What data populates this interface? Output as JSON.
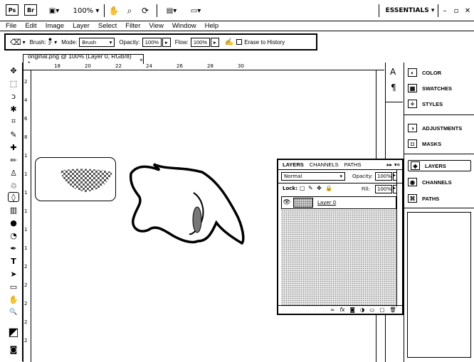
{
  "appbar": {
    "zoom": "100%",
    "workspace": "ESSENTIALS",
    "icons": [
      "ps-logo-icon",
      "bridge-icon",
      "view-extras-icon",
      "hand-icon",
      "zoom-icon",
      "rotate-view-icon",
      "arrange-documents-icon",
      "screen-mode-icon",
      "search-icon",
      "minimize-icon",
      "restore-icon",
      "close-icon"
    ]
  },
  "menu": [
    "File",
    "Edit",
    "Image",
    "Layer",
    "Select",
    "Filter",
    "View",
    "Window",
    "Help"
  ],
  "options": {
    "brush_label": "Brush:",
    "brush_size": "3\"",
    "mode_label": "Mode:",
    "mode_value": "Brush",
    "opacity_label": "Opacity:",
    "opacity_value": "100%",
    "flow_label": "Flow:",
    "flow_value": "100%",
    "erase_label": "Erase to History"
  },
  "document": {
    "tab_title": "original.png @ 100% (Layer 0, RGB/8) *",
    "close_glyph": "×",
    "ruler_top": [
      "18",
      "20",
      "22",
      "24",
      "26",
      "28",
      "30"
    ],
    "ruler_left": [
      "2",
      "4",
      "6",
      "8",
      "1",
      "1",
      "1",
      "1",
      "1",
      "1",
      "2",
      "2",
      "2",
      "2",
      "2"
    ]
  },
  "tools": [
    "move-tool",
    "marquee-tool",
    "lasso-tool",
    "magic-wand-tool",
    "crop-tool",
    "eyedropper-tool",
    "healing-tool",
    "brush-tool",
    "stamp-tool",
    "history-brush-tool",
    "eraser-tool",
    "gradient-tool",
    "blur-tool",
    "dodge-tool",
    "pen-tool",
    "type-tool",
    "path-selection-tool",
    "shape-tool",
    "hand-tool",
    "zoom-tool",
    "color-swatch",
    "quick-mask-tool"
  ],
  "tool_glyphs": [
    "✥",
    "⬚",
    "ↄ",
    "✱",
    "⌗",
    "✎",
    "✚",
    "✏",
    "♙",
    "♲",
    "◊",
    "▥",
    "●",
    "◔",
    "✒",
    "T",
    "➤",
    "▭",
    "✋",
    "🔍",
    "◩",
    "◙"
  ],
  "dock_left": {
    "glyphs": [
      "A",
      "¶"
    ]
  },
  "panels": [
    {
      "label": "COLOR",
      "glyph": "◐"
    },
    {
      "label": "SWATCHES",
      "glyph": "▦"
    },
    {
      "label": "STYLES",
      "glyph": "✧"
    },
    {
      "label": "ADJUSTMENTS",
      "glyph": "◑"
    },
    {
      "label": "MASKS",
      "glyph": "◘"
    },
    {
      "label": "LAYERS",
      "glyph": "◈"
    },
    {
      "label": "CHANNELS",
      "glyph": "◉"
    },
    {
      "label": "PATHS",
      "glyph": "⌘"
    }
  ],
  "layers_panel": {
    "tabs": [
      "LAYERS",
      "CHANNELS",
      "PATHS"
    ],
    "blend_mode": "Normal",
    "opacity_label": "Opacity:",
    "opacity": "100%",
    "lock_label": "Lock:",
    "fill_label": "Fill:",
    "fill": "100%",
    "layer_name": "Layer 0",
    "footer_icons": [
      "link-icon",
      "fx-icon",
      "mask-icon",
      "adjustment-icon",
      "group-icon",
      "new-layer-icon",
      "trash-icon"
    ],
    "footer_glyphs": [
      "∞",
      "fx",
      "◙",
      "◑",
      "▭",
      "▢",
      "🗑"
    ]
  }
}
